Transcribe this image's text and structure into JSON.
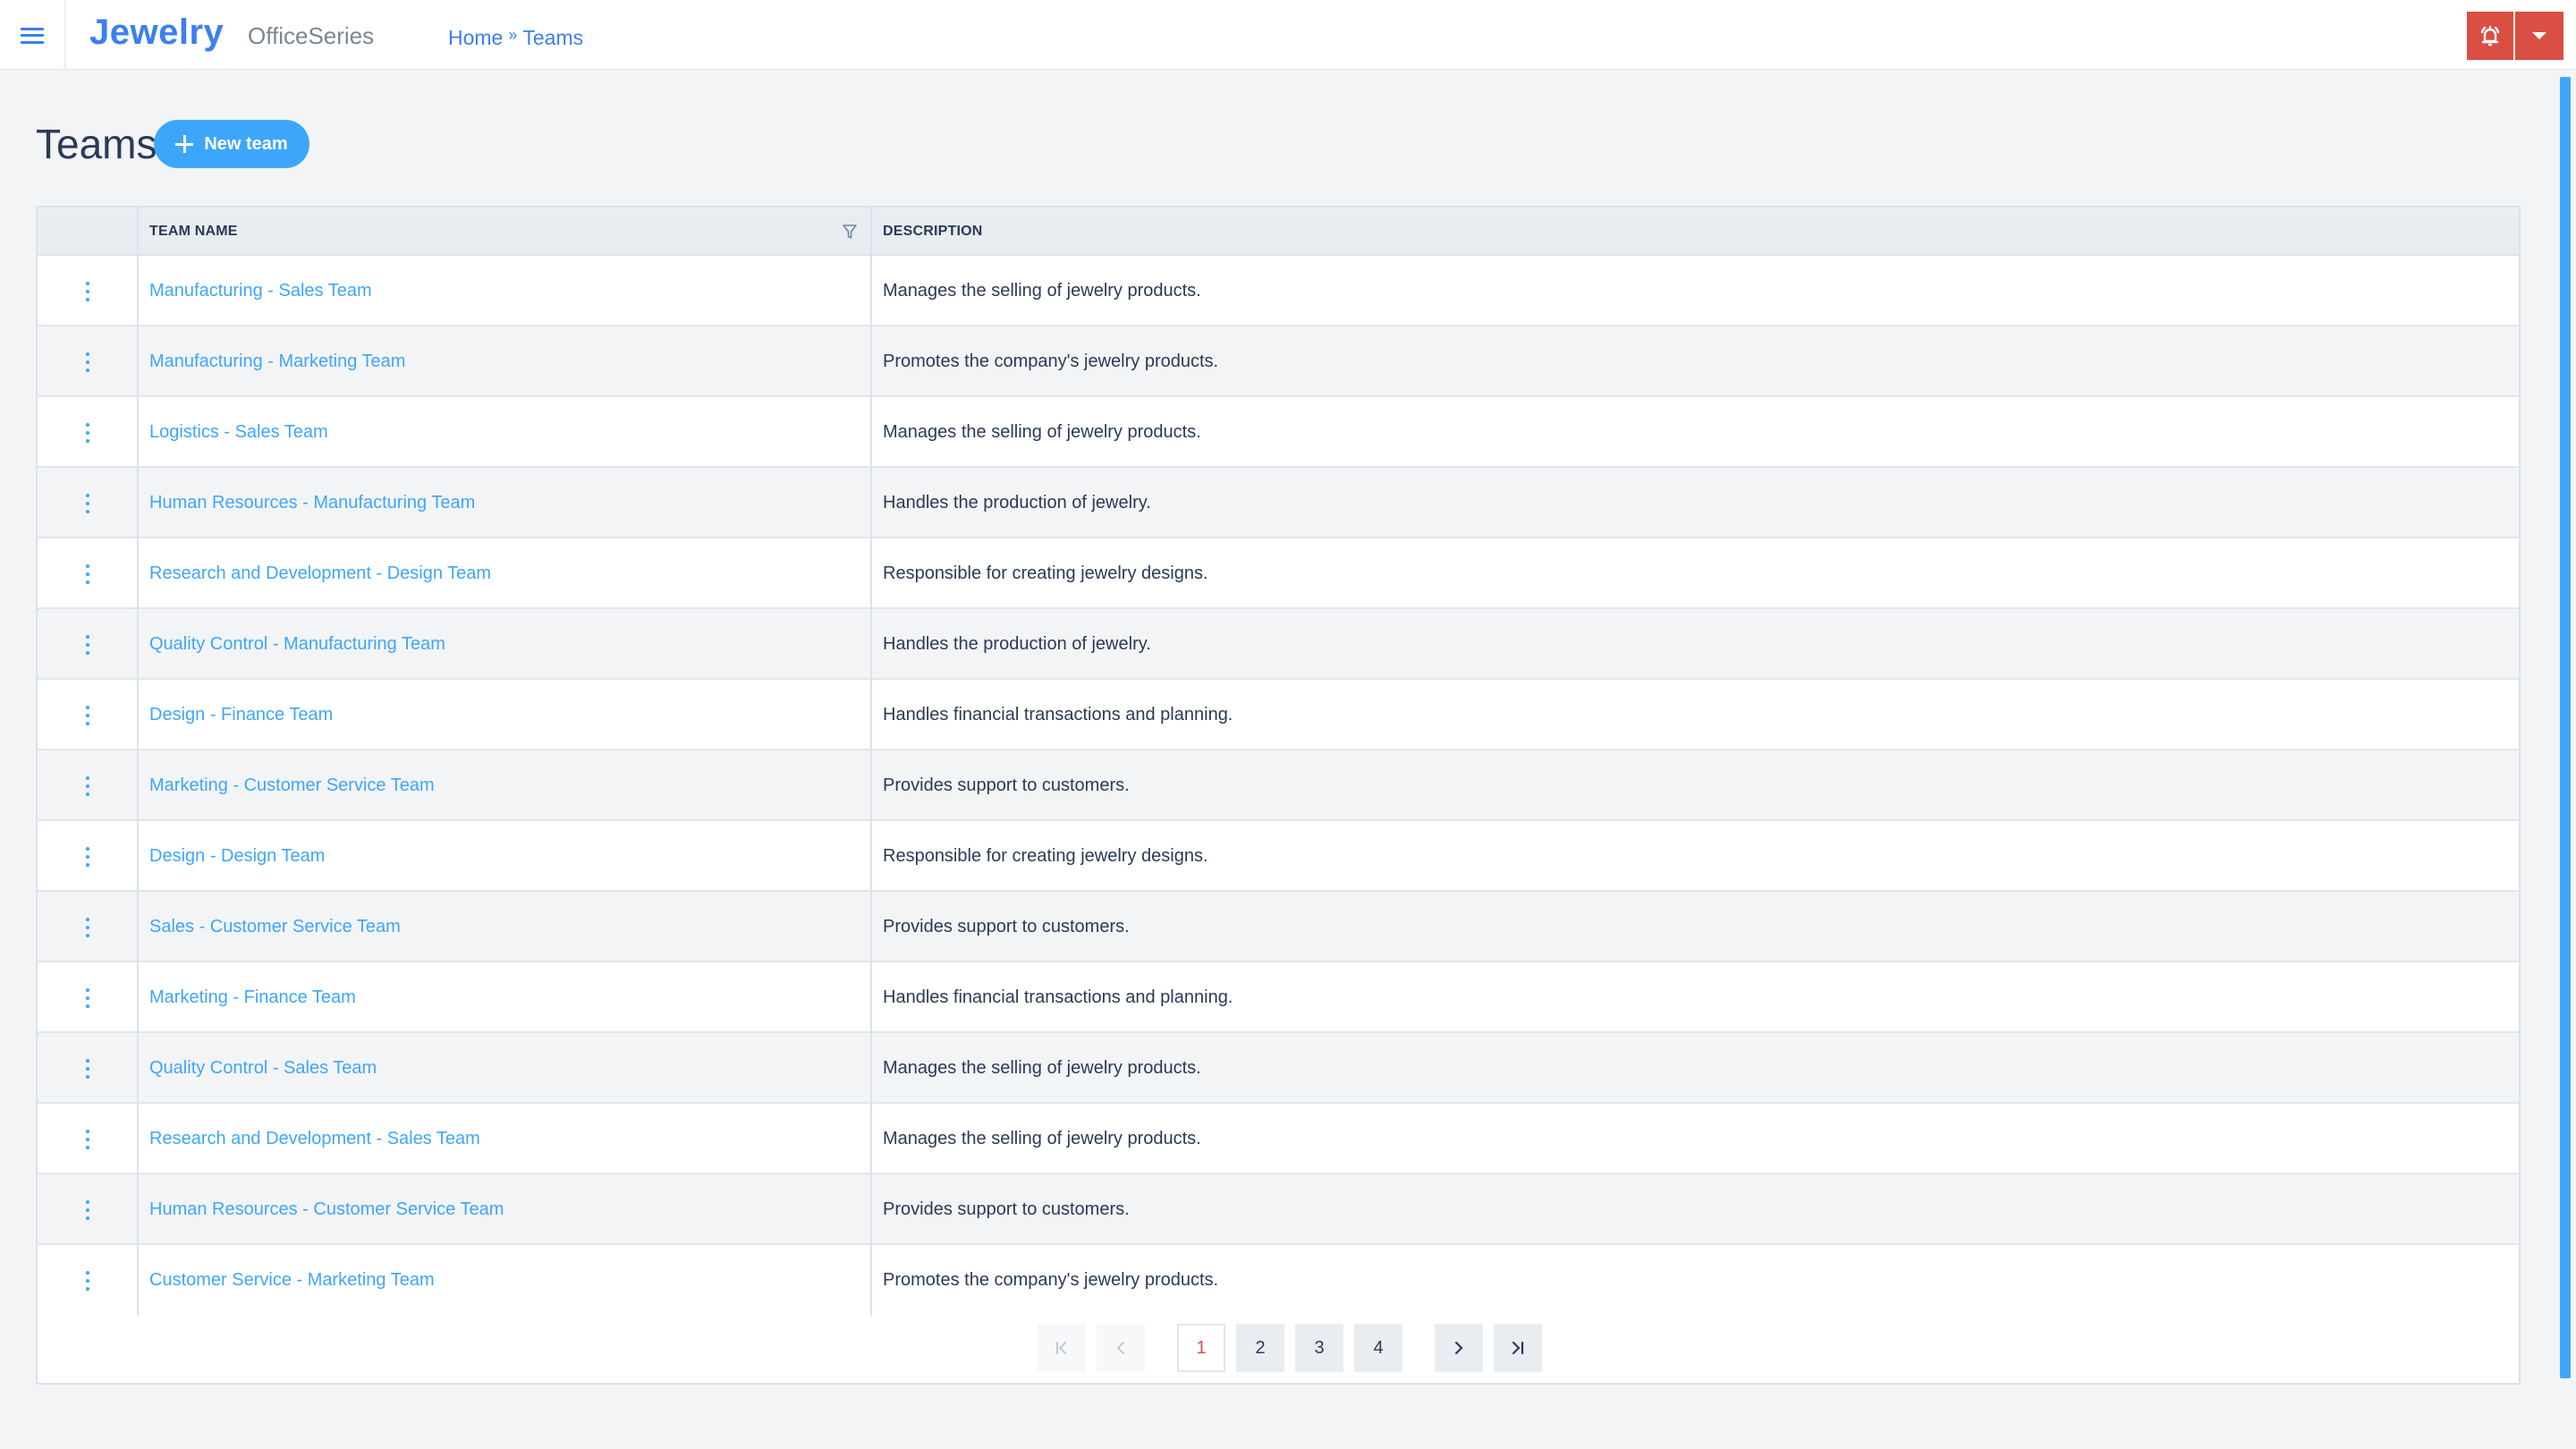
{
  "app": {
    "brand": "Jewelry",
    "product": "OfficeSeries",
    "menu_icon": "hamburger-menu-icon"
  },
  "breadcrumb": {
    "items": [
      "Home",
      "Teams"
    ],
    "separator": "»"
  },
  "header_actions": {
    "alert_icon": "bell-alert-icon",
    "dropdown_icon": "caret-down-icon",
    "alert_color": "#d94f43"
  },
  "page": {
    "title": "Teams",
    "new_button_label": "New team",
    "accent_color": "#3ea6fa"
  },
  "table": {
    "columns": [
      "",
      "TEAM NAME",
      "DESCRIPTION"
    ],
    "filter_icon": "filter-funnel-icon",
    "row_action_icon": "kebab-menu-icon",
    "rows": [
      {
        "name": "Manufacturing - Sales Team",
        "description": "Manages the selling of jewelry products."
      },
      {
        "name": "Manufacturing - Marketing Team",
        "description": "Promotes the company's jewelry products."
      },
      {
        "name": "Logistics - Sales Team",
        "description": "Manages the selling of jewelry products."
      },
      {
        "name": "Human Resources - Manufacturing Team",
        "description": "Handles the production of jewelry."
      },
      {
        "name": "Research and Development - Design Team",
        "description": "Responsible for creating jewelry designs."
      },
      {
        "name": "Quality Control - Manufacturing Team",
        "description": "Handles the production of jewelry."
      },
      {
        "name": "Design - Finance Team",
        "description": "Handles financial transactions and planning."
      },
      {
        "name": "Marketing - Customer Service Team",
        "description": "Provides support to customers."
      },
      {
        "name": "Design - Design Team",
        "description": "Responsible for creating jewelry designs."
      },
      {
        "name": "Sales - Customer Service Team",
        "description": "Provides support to customers."
      },
      {
        "name": "Marketing - Finance Team",
        "description": "Handles financial transactions and planning."
      },
      {
        "name": "Quality Control - Sales Team",
        "description": "Manages the selling of jewelry products."
      },
      {
        "name": "Research and Development - Sales Team",
        "description": "Manages the selling of jewelry products."
      },
      {
        "name": "Human Resources - Customer Service Team",
        "description": "Provides support to customers."
      },
      {
        "name": "Customer Service - Marketing Team",
        "description": "Promotes the company's jewelry products."
      }
    ]
  },
  "pagination": {
    "current_page": 1,
    "pages": [
      "1",
      "2",
      "3",
      "4"
    ],
    "first_icon": "first-page-icon",
    "prev_icon": "previous-page-icon",
    "next_icon": "next-page-icon",
    "last_icon": "last-page-icon"
  }
}
